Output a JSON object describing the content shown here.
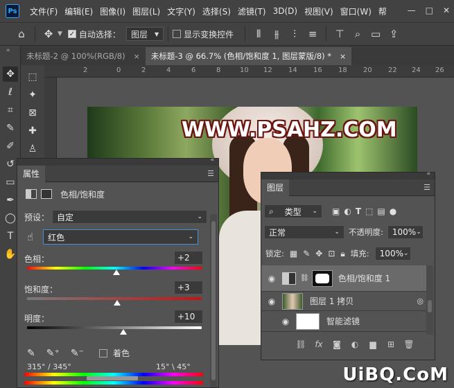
{
  "app": {
    "logo": "Ps"
  },
  "menubar": {
    "items": [
      "文件(F)",
      "编辑(E)",
      "图像(I)",
      "图层(L)",
      "文字(Y)",
      "选择(S)",
      "滤镜(T)",
      "3D(D)",
      "视图(V)",
      "窗口(W)",
      "帮"
    ],
    "window_buttons": [
      "—",
      "□",
      "✕"
    ]
  },
  "options": {
    "auto_select_label": "自动选择：",
    "auto_select_value": "图层",
    "show_transform_label": "显示变换控件"
  },
  "tabs": [
    {
      "label": "未标题-2 @ 100%(RGB/8)",
      "close": "×"
    },
    {
      "label": "未标题-3 @ 66.7% (色相/饱和度 1, 图层蒙版/8) *",
      "close": "×"
    }
  ],
  "ruler": {
    "ticks": [
      "2",
      "0",
      "2",
      "4",
      "6",
      "8",
      "10",
      "12",
      "14",
      "16",
      "18",
      "20",
      "22",
      "24",
      "26"
    ]
  },
  "canvas": {
    "watermark": "WWW.PSAHZ.COM"
  },
  "properties": {
    "tab": "属性",
    "adjustment_title": "色相/饱和度",
    "preset_label": "预设：",
    "preset_value": "自定",
    "channel_value": "红色",
    "hue_label": "色相：",
    "hue_value": "+2",
    "hue_level": 0.51,
    "saturation_label": "饱和度：",
    "saturation_value": "+3",
    "saturation_level": 0.515,
    "lightness_label": "明度：",
    "lightness_value": "+10",
    "lightness_level": 0.55,
    "colorize_label": "着色",
    "range_left": "315° / 345°",
    "range_right": "15° \\ 45°"
  },
  "layers": {
    "tab": "图层",
    "filter_kind": "类型",
    "blend_mode": "正常",
    "opacity_label": "不透明度:",
    "opacity_value": "100%",
    "lock_label": "锁定:",
    "fill_label": "填充:",
    "fill_value": "100%",
    "items": [
      {
        "name": "色相/饱和度 1"
      },
      {
        "name": "图层 1 拷贝"
      },
      {
        "name": "智能滤镜"
      }
    ]
  },
  "credit": "UiBQ.CoM"
}
